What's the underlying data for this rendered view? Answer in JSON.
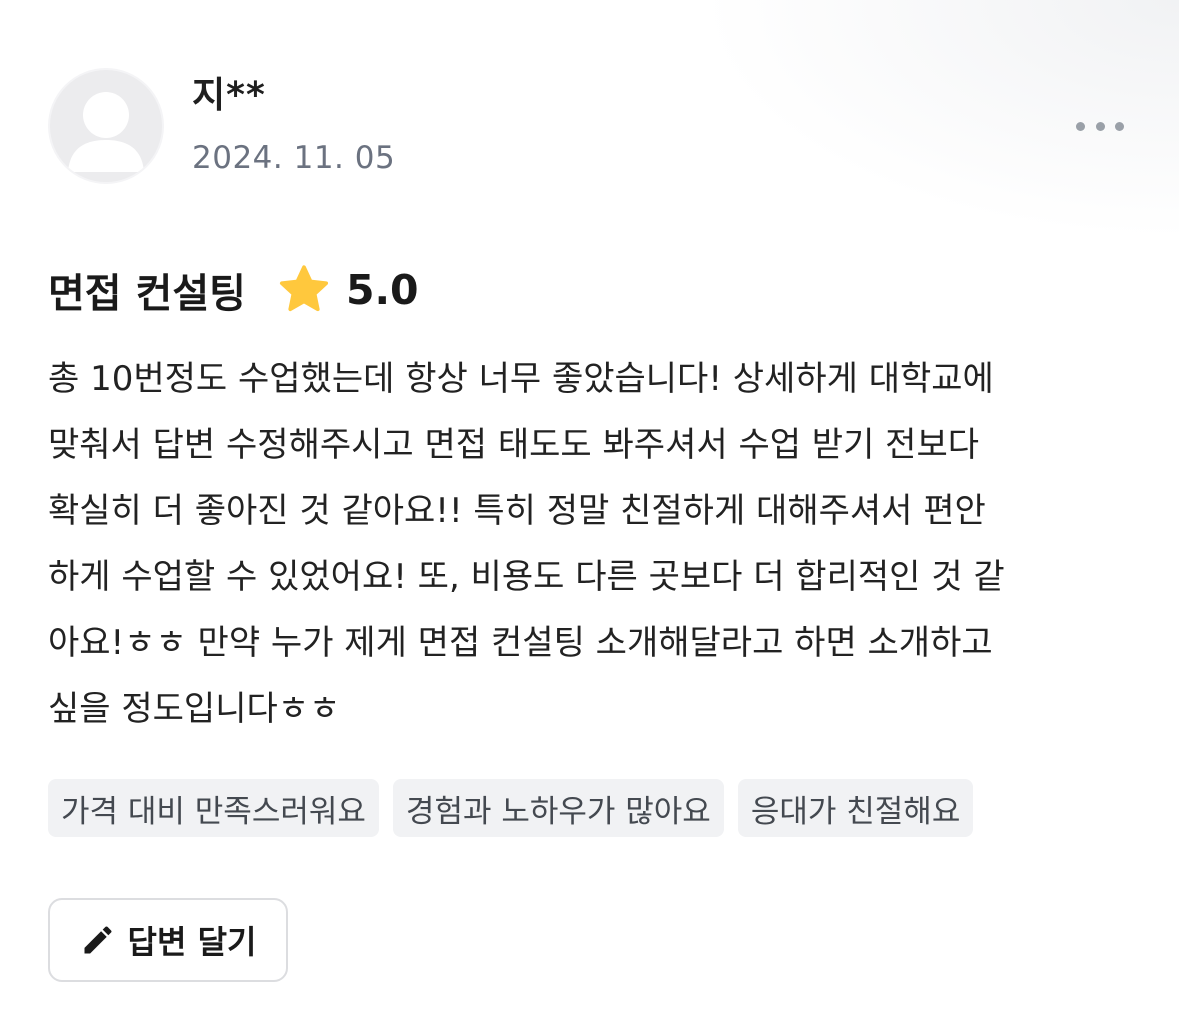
{
  "review": {
    "username": "지**",
    "date": "2024. 11. 05",
    "course_name": "면접 컨설팅",
    "rating": "5.0",
    "body_lines": [
      "총 10번정도 수업했는데 항상 너무 좋았습니다! 상세하게 대학교에",
      "맞춰서 답변 수정해주시고 면접 태도도 봐주셔서 수업 받기 전보다",
      "확실히 더 좋아진 것 같아요!! 특히 정말 친절하게 대해주셔서 편안",
      "하게 수업할 수 있었어요! 또, 비용도 다른 곳보다 더 합리적인 것 같",
      "아요!ㅎㅎ 만약 누가 제게 면접 컨설팅 소개해달라고 하면 소개하고",
      "싶을 정도입니다ㅎㅎ"
    ],
    "tags": [
      "가격 대비 만족스러워요",
      "경험과 노하우가 많아요",
      "응대가 친절해요"
    ]
  },
  "actions": {
    "reply_label": "답변 달기"
  },
  "icons": {
    "avatar": "default-user-avatar",
    "more": "more-horizontal-icon",
    "star": "star-icon",
    "pencil": "pencil-icon"
  },
  "colors": {
    "star": "#FFC83D",
    "date_text": "#6b7280",
    "tag_bg": "#f1f2f4",
    "tag_text": "#444950",
    "button_border": "#dcdde0"
  }
}
